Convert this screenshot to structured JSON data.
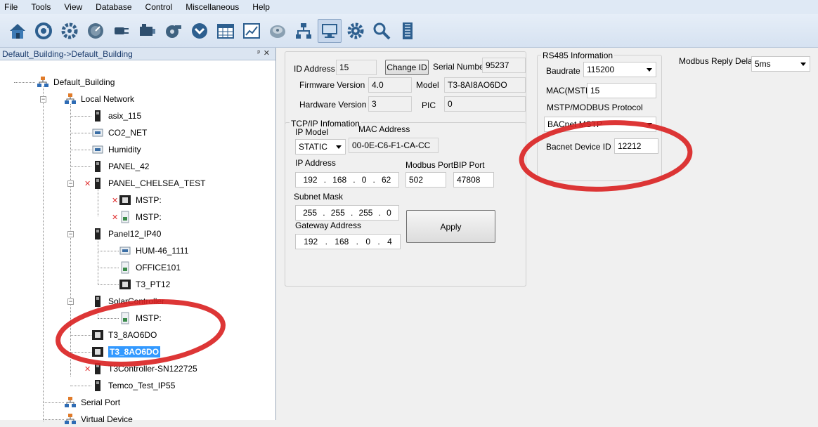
{
  "menu": [
    "File",
    "Tools",
    "View",
    "Database",
    "Control",
    "Miscellaneous",
    "Help"
  ],
  "toolbar_icons": [
    "home-icon",
    "refresh-gear-icon",
    "gear-sync-icon",
    "dial-icon",
    "plug-icon",
    "network-card-icon",
    "fan-icon",
    "chevron-down-circle-icon",
    "calendar-grid-icon",
    "chart-icon",
    "disk-icon",
    "hierarchy-icon",
    "monitor-icon",
    "settings-gear-icon",
    "magnifier-icon",
    "building-icon"
  ],
  "left": {
    "header": "Default_Building->Default_Building",
    "pin": "ᵖ",
    "close": "✕",
    "tree": [
      {
        "label": "Default_Building"
      },
      {
        "label": "Local Network"
      },
      {
        "label": "asix_115"
      },
      {
        "label": "CO2_NET"
      },
      {
        "label": "Humidity"
      },
      {
        "label": "PANEL_42"
      },
      {
        "label": "PANEL_CHELSEA_TEST"
      },
      {
        "label": "MSTP:"
      },
      {
        "label": "MSTP:"
      },
      {
        "label": "Panel12_IP40"
      },
      {
        "label": "HUM-46_1111"
      },
      {
        "label": "OFFICE101"
      },
      {
        "label": "T3_PT12"
      },
      {
        "label": "SolarController"
      },
      {
        "label": "MSTP:"
      },
      {
        "label": "T3_8AO6DO"
      },
      {
        "label": "T3_8AO6DO"
      },
      {
        "label": "T3Controller-SN122725"
      },
      {
        "label": "Temco_Test_IP55"
      },
      {
        "label": "Serial Port"
      },
      {
        "label": "Virtual Device"
      }
    ]
  },
  "device": {
    "id_label": "ID Address",
    "id_value": "15",
    "change_id_button": "Change ID",
    "serial_label": "Serial Number",
    "serial_value": "95237",
    "fw_label": "Firmware Version",
    "fw_value": "4.0",
    "model_label": "Model",
    "model_value": "T3-8AI8AO6DO",
    "hw_label": "Hardware Version",
    "hw_value": "3",
    "pic_label": "PIC",
    "pic_value": "0"
  },
  "tcpip": {
    "title": "TCP/IP Infomation",
    "ip_model_label": "IP Model",
    "ip_model_value": "STATIC",
    "mac_label": "MAC Address",
    "mac_value": "00-0E-C6-F1-CA-CC",
    "ip_label": "IP Address",
    "ip": [
      "192",
      "168",
      "0",
      "62"
    ],
    "modbus_port_label": "Modbus Port",
    "modbus_port_value": "502",
    "bip_port_label": "BIP Port",
    "bip_port_value": "47808",
    "subnet_label": "Subnet Mask",
    "subnet": [
      "255",
      "255",
      "255",
      "0"
    ],
    "gateway_label": "Gateway Address",
    "gateway": [
      "192",
      "168",
      "0",
      "4"
    ],
    "apply_button": "Apply"
  },
  "rs485": {
    "title": "RS485 Information",
    "baud_label": "Baudrate",
    "baud_value": "115200",
    "mac_label": "MAC(MSTP)",
    "mac_value": "15",
    "protocol_label": "MSTP/MODBUS Protocol",
    "protocol_value": "BACnet MSTP",
    "bacnet_id_label": "Bacnet Device ID :",
    "bacnet_id_value": "12212"
  },
  "modbus_delay": {
    "label": "Modbus Reply Delay",
    "value": "5ms"
  },
  "colors": {
    "annotation": "#d92020",
    "selection": "#3399ff"
  }
}
